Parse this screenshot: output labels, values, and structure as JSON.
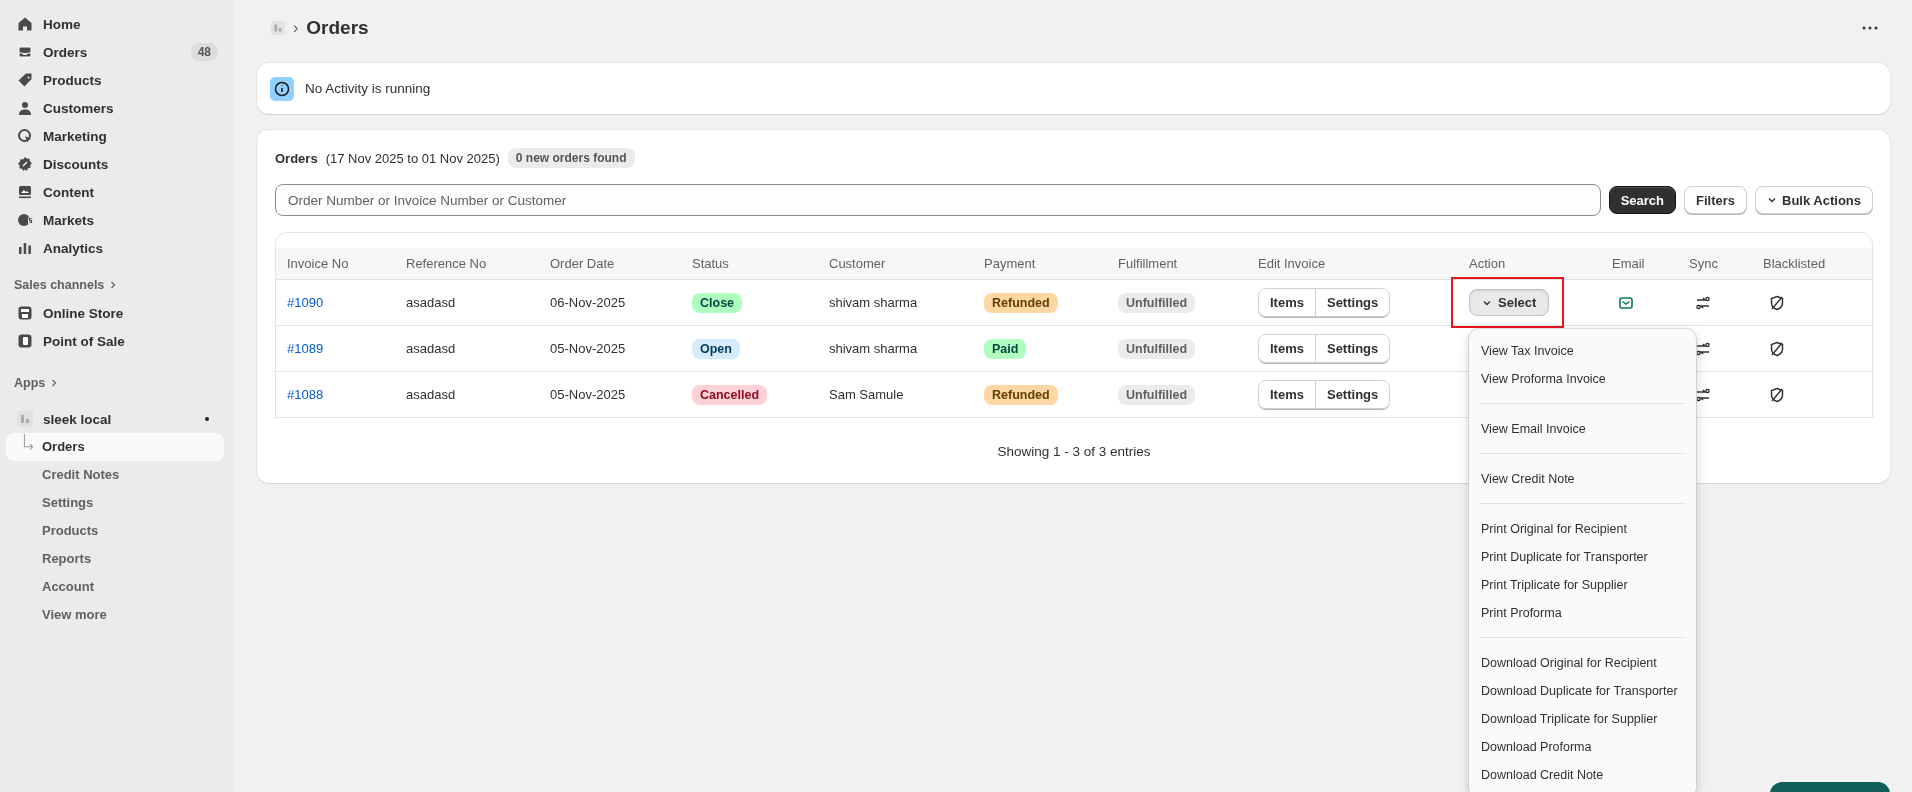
{
  "sidebar": {
    "items": [
      {
        "label": "Home"
      },
      {
        "label": "Orders",
        "badge": "48"
      },
      {
        "label": "Products"
      },
      {
        "label": "Customers"
      },
      {
        "label": "Marketing"
      },
      {
        "label": "Discounts"
      },
      {
        "label": "Content"
      },
      {
        "label": "Markets"
      },
      {
        "label": "Analytics"
      }
    ],
    "sales_channels": {
      "label": "Sales channels",
      "items": [
        {
          "label": "Online Store"
        },
        {
          "label": "Point of Sale"
        }
      ]
    },
    "apps": {
      "label": "Apps"
    },
    "app": {
      "name": "sleek local",
      "items": [
        {
          "label": "Orders",
          "selected": true
        },
        {
          "label": "Credit Notes",
          "selected": false
        },
        {
          "label": "Settings",
          "selected": false
        },
        {
          "label": "Products",
          "selected": false
        },
        {
          "label": "Reports",
          "selected": false
        },
        {
          "label": "Account",
          "selected": false
        },
        {
          "label": "View more",
          "selected": false
        }
      ]
    }
  },
  "header": {
    "separator": "›",
    "title": "Orders"
  },
  "notice": {
    "text": "No Activity is running"
  },
  "orders": {
    "title": "Orders",
    "range": "(17 Nov 2025 to 01 Nov 2025)",
    "badge": "0 new orders found",
    "search": {
      "placeholder": "Order Number or Invoice Number or Customer"
    },
    "buttons": [
      {
        "label": "Search",
        "kind": "primary"
      },
      {
        "label": "Filters",
        "kind": "plain"
      },
      {
        "label": "Bulk Actions",
        "kind": "menu"
      }
    ],
    "table": {
      "columns": [
        "Invoice No",
        "Reference No",
        "Order Date",
        "Status",
        "Customer",
        "Payment",
        "Fulfillment",
        "Edit Invoice",
        "Action",
        "Email",
        "Sync",
        "Blacklisted"
      ],
      "rows": [
        {
          "invoice": "#1090",
          "reference": "asadasd",
          "date": "06-Nov-2025",
          "status": {
            "label": "Close",
            "color": "#affebf"
          },
          "customer": "shivam sharma",
          "payment": {
            "label": "Refunded",
            "color": "#ffd6a4"
          },
          "fulfillment": {
            "label": "Unfulfilled",
            "color": "#ebebeb"
          },
          "edit": [
            "Items",
            "Settings"
          ],
          "action": {
            "label": "Select",
            "open": true,
            "highlighted": true
          }
        },
        {
          "invoice": "#1089",
          "reference": "asadasd",
          "date": "05-Nov-2025",
          "status": {
            "label": "Open",
            "color": "#d5ebff"
          },
          "customer": "shivam sharma",
          "payment": {
            "label": "Paid",
            "color": "#affebf"
          },
          "fulfillment": {
            "label": "Unfulfilled",
            "color": "#ebebeb"
          },
          "edit": [
            "Items",
            "Settings"
          ]
        },
        {
          "invoice": "#1088",
          "reference": "asadasd",
          "date": "05-Nov-2025",
          "status": {
            "label": "Cancelled",
            "color": "#fed1d7"
          },
          "customer": "Sam Samule",
          "payment": {
            "label": "Refunded",
            "color": "#ffd6a4"
          },
          "fulfillment": {
            "label": "Unfulfilled",
            "color": "#ebebeb"
          },
          "edit": [
            "Items",
            "Settings"
          ]
        }
      ]
    },
    "action_menu": {
      "groups": [
        [
          "View Tax Invoice",
          "View Proforma Invoice"
        ],
        [
          "View Email Invoice"
        ],
        [
          "View Credit Note"
        ],
        [
          "Print Original for Recipient",
          "Print Duplicate for Transporter",
          "Print Triplicate for Supplier",
          "Print Proforma"
        ],
        [
          "Download Original for Recipient",
          "Download Duplicate for Transporter",
          "Download Triplicate for Supplier",
          "Download Proforma",
          "Download Credit Note"
        ]
      ]
    },
    "footer": "Showing 1 - 3 of 3 entries"
  }
}
